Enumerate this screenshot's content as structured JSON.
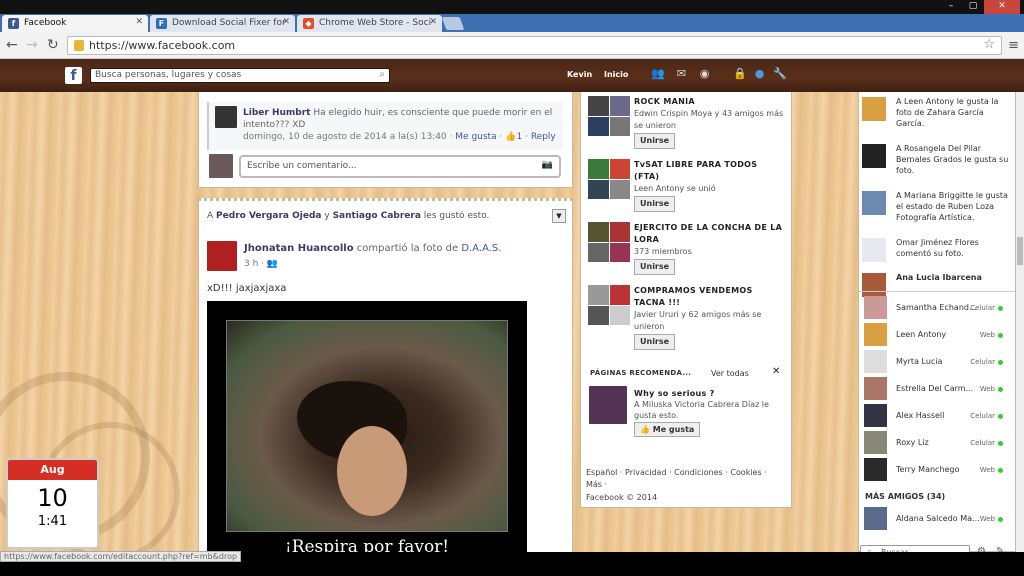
{
  "browser": {
    "tabs": [
      {
        "label": "Facebook",
        "icon": "facebook-icon"
      },
      {
        "label": "Download Social Fixer for",
        "icon": "socialfixer-icon"
      },
      {
        "label": "Chrome Web Store - Soci",
        "icon": "webstore-icon"
      }
    ],
    "url": "https://www.facebook.com",
    "status_url": "https://www.facebook.com/editaccount.php?ref=mb&drop"
  },
  "fbbar": {
    "search_placeholder": "Busca personas, lugares y cosas",
    "user": "Kevin",
    "home": "Inicio"
  },
  "feed": {
    "comment": {
      "author": "Liber Humbrt",
      "text": "Ha elegido huir, es consciente que puede morir en el intento??? XD",
      "date": "domingo, 10 de agosto de 2014 a la(s) 13:40",
      "like_label": "Me gusta",
      "likes": "1",
      "reply_label": "Reply"
    },
    "write_comment_placeholder": "Escribe un comentario...",
    "post": {
      "liked_by_prefix": "A",
      "liked_by_1": "Pedro Vergara Ojeda",
      "liked_by_and": "y",
      "liked_by_2": "Santiago Cabrera",
      "liked_by_suffix": "les gustó esto.",
      "author": "Jhonatan Huancollo",
      "action": "compartió la foto de",
      "source": "D.A.A.S.",
      "time": "3 h",
      "caption": "xD!!! jaxjaxjaxa",
      "image_caption": "¡Respira por favor!"
    }
  },
  "groups": [
    {
      "title": "ROCK MANIA",
      "sub": "Edwin Crispin Moya y 43 amigos más se unieron",
      "button": "Unirse"
    },
    {
      "title": "TvSAT LIBRE PARA TODOS (FTA)",
      "sub": "Leen Antony se unió",
      "button": "Unirse"
    },
    {
      "title": "EJERCITO DE LA CONCHA DE LA LORA",
      "sub": "373 miembros",
      "button": "Unirse"
    },
    {
      "title": "COMPRAMOS VENDEMOS TACNA !!!",
      "sub": "Javier Ururi y 62 amigos más se unieron",
      "button": "Unirse"
    }
  ],
  "pages": {
    "header": "PÁGINAS RECOMENDA...",
    "see_all": "Ver todas",
    "item_title": "Why so serious ?",
    "item_sub": "A Miluska Victoria Cabrera Díaz le gusta esto.",
    "like_button": "Me gusta"
  },
  "footer": {
    "links": "Español · Privacidad · Condiciones · Cookies · Más ·",
    "copyright": "Facebook © 2014"
  },
  "ticker": [
    {
      "text": "A Leen Antony le gusta la foto de Zahara García García."
    },
    {
      "text": "A Rosangela Del Pilar Bernales Grados le gusta su foto."
    },
    {
      "text": "A Mariana Briggitte le gusta el estado de Ruben Loza Fotografía Artística."
    },
    {
      "text": "Omar Jiménez Flores comentó su foto."
    },
    {
      "text": "Ana Lucia Ibarcena"
    }
  ],
  "chat": {
    "contacts": [
      {
        "name": "Samantha Echand...",
        "status": "Celular"
      },
      {
        "name": "Leen Antony",
        "status": "Web"
      },
      {
        "name": "Myrta Lucia",
        "status": "Celular"
      },
      {
        "name": "Estrella Del Carm...",
        "status": "Web"
      },
      {
        "name": "Alex Hassell",
        "status": "Celular"
      },
      {
        "name": "Roxy Liz",
        "status": "Celular"
      },
      {
        "name": "Terry Manchego",
        "status": "Web"
      }
    ],
    "more_friends": "MÁS AMIGOS (34)",
    "more_contacts": [
      {
        "name": "Aldana Salcedo Ma...",
        "status": "Web"
      }
    ],
    "search_placeholder": "Buscar"
  },
  "calendar": {
    "month": "Aug",
    "day": "10",
    "time": "1:41"
  }
}
